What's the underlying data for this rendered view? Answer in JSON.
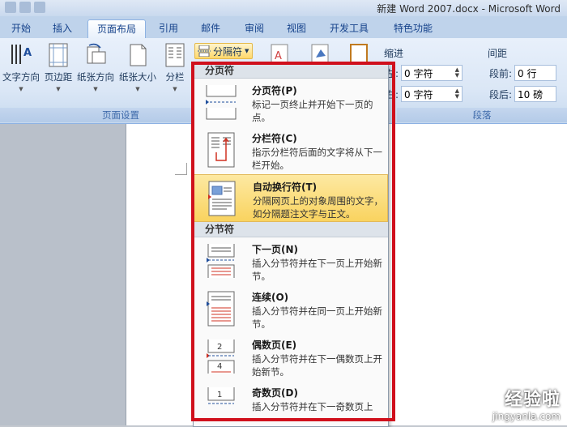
{
  "window": {
    "title": "新建 Word 2007.docx - Microsoft Word"
  },
  "tabs": [
    {
      "label": "开始"
    },
    {
      "label": "插入"
    },
    {
      "label": "页面布局"
    },
    {
      "label": "引用"
    },
    {
      "label": "邮件"
    },
    {
      "label": "审阅"
    },
    {
      "label": "视图"
    },
    {
      "label": "开发工具"
    },
    {
      "label": "特色功能"
    }
  ],
  "ribbon": {
    "page_setup": {
      "label": "页面设置",
      "buttons": [
        {
          "label": "文字方向"
        },
        {
          "label": "页边距"
        },
        {
          "label": "纸张方向"
        },
        {
          "label": "纸张大小"
        },
        {
          "label": "分栏"
        }
      ],
      "breaks_button": "分隔符"
    },
    "paragraph": {
      "label": "段落",
      "indent_header": "缩进",
      "spacing_header": "间距",
      "left_label": "左:",
      "left_value": "0 字符",
      "right_label": "右:",
      "right_value": "0 字符",
      "before_label": "段前:",
      "before_value": "0 行",
      "after_label": "段后:",
      "after_value": "10 磅"
    }
  },
  "menu": {
    "page_breaks_header": "分页符",
    "section_breaks_header": "分节符",
    "page_items": [
      {
        "title": "分页符(P)",
        "desc": "标记一页终止并开始下一页的点。"
      },
      {
        "title": "分栏符(C)",
        "desc": "指示分栏符后面的文字将从下一栏开始。"
      },
      {
        "title": "自动换行符(T)",
        "desc": "分隔网页上的对象周围的文字，如分隔题注文字与正文。"
      }
    ],
    "section_items": [
      {
        "title": "下一页(N)",
        "desc": "插入分节符并在下一页上开始新节。"
      },
      {
        "title": "连续(O)",
        "desc": "插入分节符并在同一页上开始新节。"
      },
      {
        "title": "偶数页(E)",
        "desc": "插入分节符并在下一偶数页上开始新节。"
      },
      {
        "title": "奇数页(D)",
        "desc": "插入分节符并在下一奇数页上"
      }
    ]
  },
  "watermark": {
    "brand": "经验啦",
    "url": "jingyanla.com"
  },
  "colors": {
    "annotation": "#d0101c",
    "highlight": "#f9d35f",
    "accent": "#15428b"
  }
}
